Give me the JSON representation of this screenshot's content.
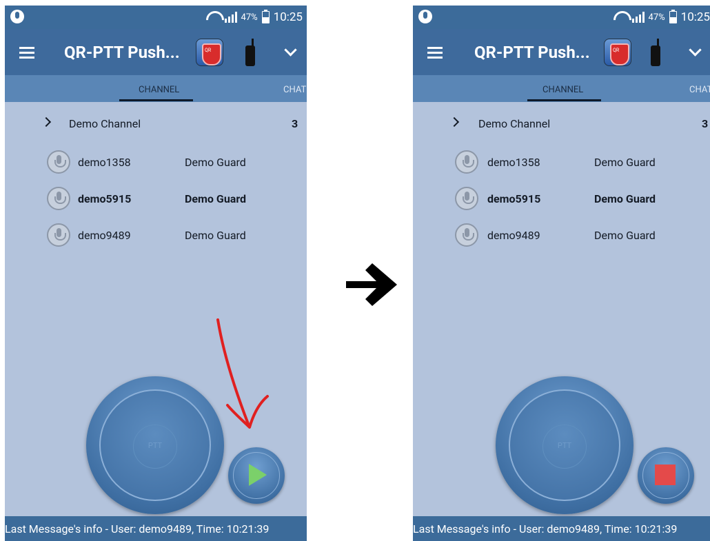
{
  "status_bar": {
    "battery_percent": "47%",
    "time": "10:25"
  },
  "app_bar": {
    "title": "QR-PTT Push..."
  },
  "tabs": [
    {
      "label": "CHANNEL",
      "active": true
    },
    {
      "label": "CHAT",
      "active": false
    }
  ],
  "channel": {
    "name": "Demo Channel",
    "member_count": "3"
  },
  "members": [
    {
      "name": "demo1358",
      "role": "Demo Guard",
      "bold": false
    },
    {
      "name": "demo5915",
      "role": "Demo Guard",
      "bold": true
    },
    {
      "name": "demo9489",
      "role": "Demo Guard",
      "bold": false
    }
  ],
  "ptt": {
    "label": "PTT"
  },
  "footer": {
    "last_message": "Last Message's info - User: demo9489, Time: 10:21:39"
  },
  "icons": {
    "left_playback": "play-icon",
    "right_playback": "stop-icon",
    "transition": "arrow-right-icon",
    "annotation": "red-hand-drawn-arrow"
  },
  "colors": {
    "app_bar": "#3e6a9c",
    "tab_bar": "#5a86b6",
    "background": "#b3c3dc",
    "play": "#7bd06a",
    "stop": "#e44a4a",
    "annotation": "#e02020"
  }
}
